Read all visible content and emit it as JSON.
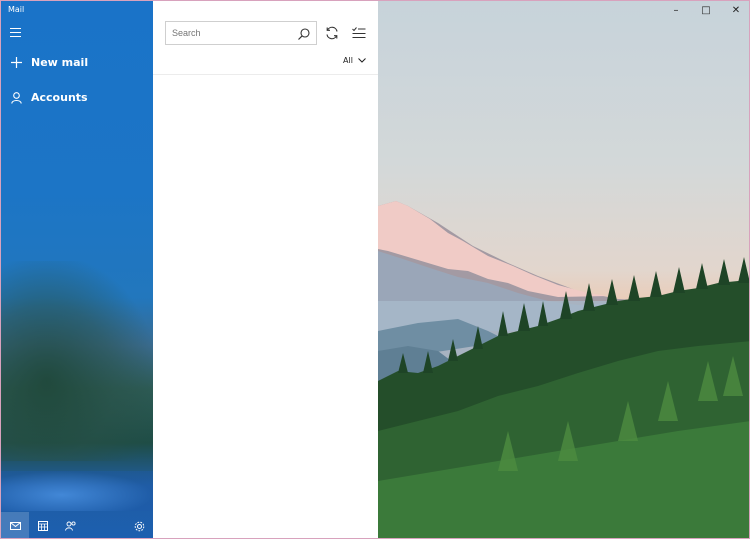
{
  "window": {
    "title": "Mail"
  },
  "sidebar": {
    "new_mail_label": "New mail",
    "accounts_label": "Accounts",
    "bottom_icons": [
      "mail-icon",
      "calendar-icon",
      "people-icon",
      "settings-icon"
    ]
  },
  "list": {
    "search_placeholder": "Search",
    "filter_label": "All"
  },
  "titlebar": {
    "minimize": "–",
    "maximize": "□",
    "close": "✕"
  },
  "colors": {
    "accent": "#1a73c8",
    "window_border": "#d8a2bd"
  }
}
